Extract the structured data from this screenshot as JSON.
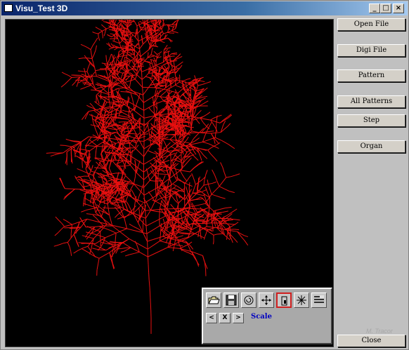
{
  "window": {
    "title": "Visu_Test 3D",
    "min_glyph": "_",
    "max_glyph": "□",
    "close_glyph": "×"
  },
  "sidebar": {
    "buttons": [
      {
        "label": "Open File"
      },
      {
        "label": "Digi File"
      },
      {
        "label": "Pattern"
      },
      {
        "label": "All Patterns"
      },
      {
        "label": "Step"
      },
      {
        "label": "Organ"
      }
    ],
    "close_label": "Close"
  },
  "watermark": {
    "text": "M. Tracor"
  },
  "toolbox": {
    "tools": [
      {
        "icon": "open-folder-icon"
      },
      {
        "icon": "save-disk-icon"
      },
      {
        "icon": "rotate-icon"
      },
      {
        "icon": "move-arrows-icon"
      },
      {
        "icon": "scale-icon",
        "active": true
      },
      {
        "icon": "axes-star-icon"
      },
      {
        "icon": "layers-icon"
      }
    ],
    "prev_label": "<",
    "axis_label": "X",
    "next_label": ">",
    "mode_label": "Scale"
  },
  "colors": {
    "plant": "#e81010",
    "canvas": "#000000",
    "mode_label": "#0000c0"
  }
}
